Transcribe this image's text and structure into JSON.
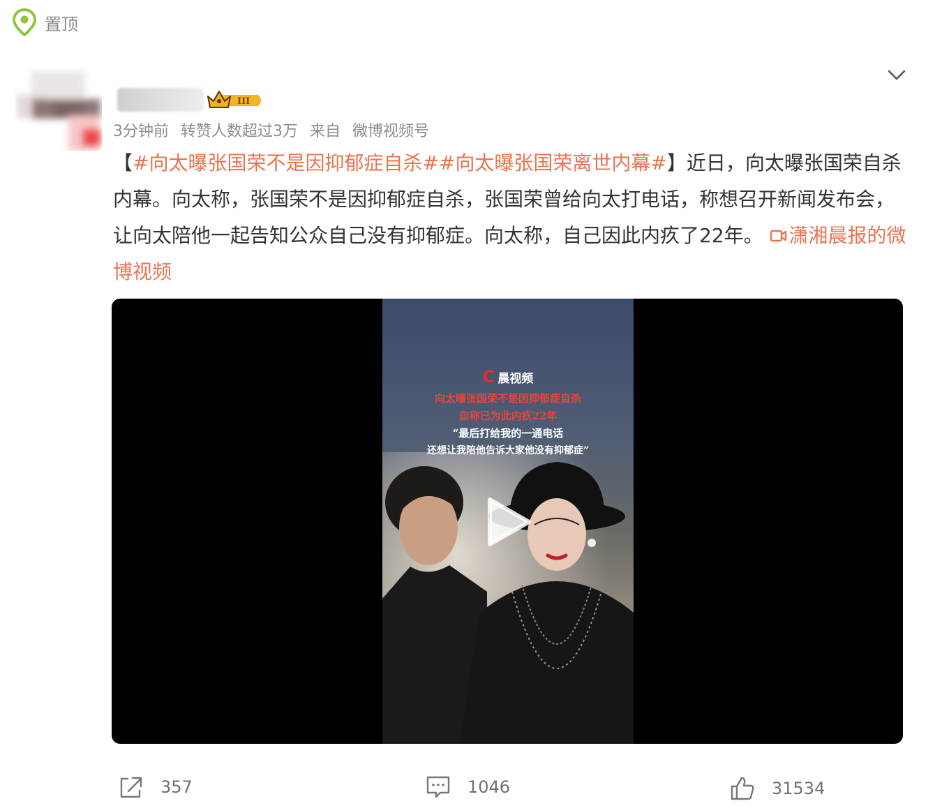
{
  "pinned": {
    "label": "置顶"
  },
  "post": {
    "meta": {
      "time": "3分钟前",
      "repost_note": "转赞人数超过3万",
      "source_prefix": "来自",
      "source": "微博视频号"
    },
    "text": {
      "bracket_open": "【",
      "hashtags": "#向太曝张国荣不是因抑郁症自杀##向太曝张国荣离世内幕#",
      "bracket_close": "】",
      "body": "近日，向太曝张国荣自杀内幕。向太称，张国荣不是因抑郁症自杀，张国荣曾给向太打电话，称想召开新闻发布会，让向太陪他一起告知公众自己没有抑郁症。向太称，自己因此内疚了22年。",
      "video_link": "潇湘晨报的微博视频"
    }
  },
  "video": {
    "brand": "晨视频",
    "caption_lines": [
      "向太曝张国荣不是因抑郁症自杀",
      "自称已为此内疚22年",
      "“最后打给我的一通电话",
      "还想让我陪他告诉大家他没有抑郁症”"
    ]
  },
  "actions": {
    "share_count": "357",
    "comment_count": "1046",
    "like_count": "31534"
  },
  "colors": {
    "link": "#eb7350",
    "pin_green": "#8ec43f",
    "meta_gray": "#8c8c8c",
    "caption_red": "#e8453d"
  },
  "icons": [
    "pin-icon",
    "chevron-down-icon",
    "crown-badge-icon",
    "play-icon",
    "share-icon",
    "comment-icon",
    "like-icon"
  ]
}
